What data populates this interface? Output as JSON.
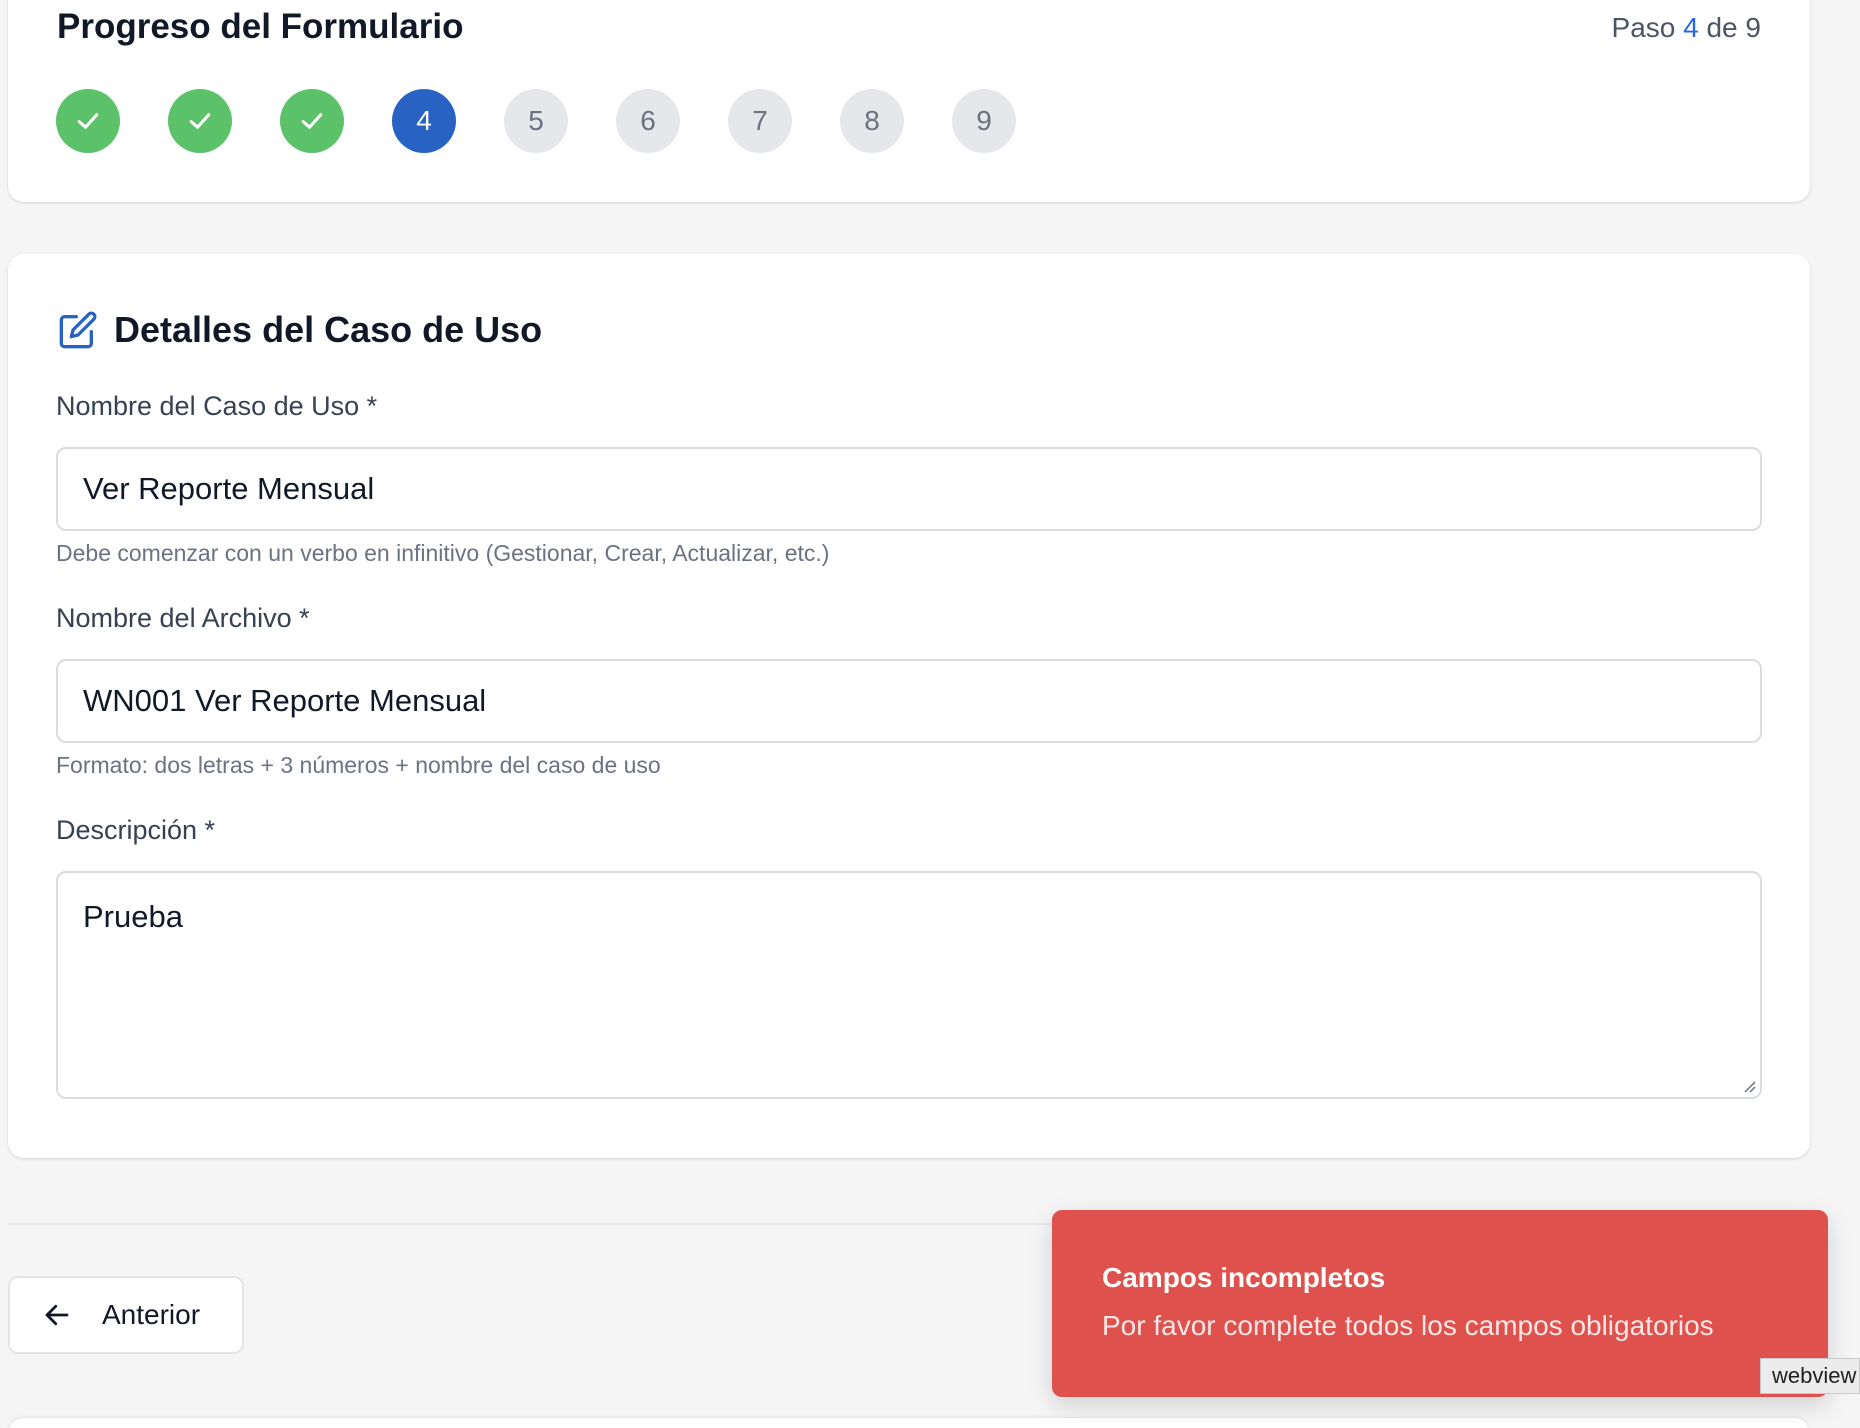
{
  "progress": {
    "title": "Progreso del Formulario",
    "step_prefix": "Paso",
    "current_step": "4",
    "step_separator": "de",
    "total_steps": "9",
    "steps": [
      {
        "label": "1",
        "state": "done"
      },
      {
        "label": "2",
        "state": "done"
      },
      {
        "label": "3",
        "state": "done"
      },
      {
        "label": "4",
        "state": "active"
      },
      {
        "label": "5",
        "state": "pending"
      },
      {
        "label": "6",
        "state": "pending"
      },
      {
        "label": "7",
        "state": "pending"
      },
      {
        "label": "8",
        "state": "pending"
      },
      {
        "label": "9",
        "state": "pending"
      }
    ]
  },
  "details": {
    "title": "Detalles del Caso de Uso",
    "icon": "edit-icon",
    "use_case_name": {
      "label": "Nombre del Caso de Uso *",
      "value": "Ver Reporte Mensual",
      "hint": "Debe comenzar con un verbo en infinitivo (Gestionar, Crear, Actualizar, etc.)"
    },
    "file_name": {
      "label": "Nombre del Archivo *",
      "value": "WN001 Ver Reporte Mensual",
      "hint": "Formato: dos letras + 3 números + nombre del caso de uso"
    },
    "description": {
      "label": "Descripción *",
      "value": "Prueba"
    }
  },
  "footer": {
    "prev_label": "Anterior"
  },
  "toast": {
    "title": "Campos incompletos",
    "description": "Por favor complete todos los campos obligatorios"
  },
  "webview_tag": "webview",
  "colors": {
    "accent": "#2862c2",
    "done": "#5cc26a",
    "pending": "#e5e7eb",
    "toast_error": "#df514c"
  }
}
